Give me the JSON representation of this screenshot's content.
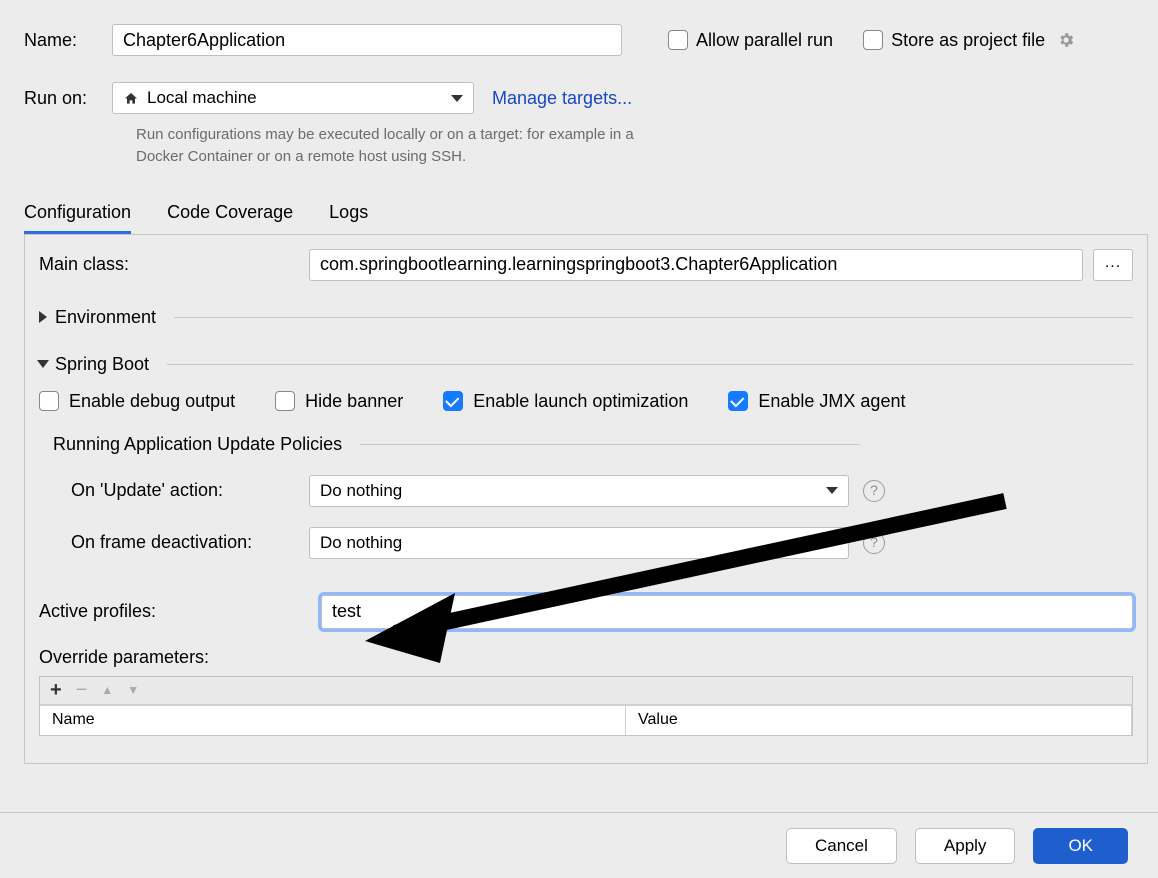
{
  "top": {
    "name_label": "Name:",
    "name_value": "Chapter6Application",
    "allow_parallel_label": "Allow parallel run",
    "store_project_label": "Store as project file",
    "runon_label": "Run on:",
    "runon_value": "Local machine",
    "manage_targets": "Manage targets...",
    "hint": "Run configurations may be executed locally or on a target: for example in a Docker Container or on a remote host using SSH."
  },
  "tabs": {
    "configuration": "Configuration",
    "coverage": "Code Coverage",
    "logs": "Logs"
  },
  "panel": {
    "main_class_label": "Main class:",
    "main_class_value": "com.springbootlearning.learningspringboot3.Chapter6Application",
    "browse": "...",
    "environment": "Environment",
    "spring_boot": "Spring Boot",
    "checks": {
      "debug": "Enable debug output",
      "hide_banner": "Hide banner",
      "launch_opt": "Enable launch optimization",
      "jmx": "Enable JMX agent"
    },
    "policies_title": "Running Application Update Policies",
    "on_update_label": "On 'Update' action:",
    "on_update_value": "Do nothing",
    "on_frame_label": "On frame deactivation:",
    "on_frame_value": "Do nothing",
    "active_profiles_label": "Active profiles:",
    "active_profiles_value": "test",
    "override_label": "Override parameters:",
    "override_cols": {
      "name": "Name",
      "value": "Value"
    },
    "toolbar": {
      "plus": "+",
      "minus": "−",
      "up": "▲",
      "down": "▼"
    }
  },
  "footer": {
    "cancel": "Cancel",
    "apply": "Apply",
    "ok": "OK"
  }
}
